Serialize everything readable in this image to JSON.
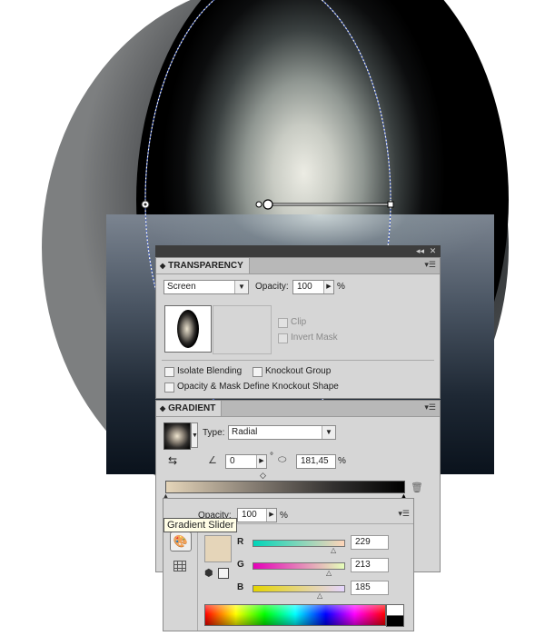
{
  "transparency": {
    "tab_title": "TRANSPARENCY",
    "blend_mode": "Screen",
    "opacity_label": "Opacity:",
    "opacity_value": "100",
    "percent": "%",
    "clip_label": "Clip",
    "invert_mask_label": "Invert Mask",
    "isolate_blending_label": "Isolate Blending",
    "knockout_group_label": "Knockout Group",
    "opacity_mask_label": "Opacity & Mask Define Knockout Shape"
  },
  "gradient": {
    "tab_title": "GRADIENT",
    "type_label": "Type:",
    "type_value": "Radial",
    "angle_value": "0",
    "degree_symbol": "°",
    "aspect_value": "181,45",
    "percent": "%"
  },
  "tooltip": {
    "text": "Gradient Slider"
  },
  "color": {
    "opacity_label": "Opacity:",
    "opacity_value": "100",
    "percent": "%",
    "swatch": "#e5d5b9",
    "r_label": "R",
    "g_label": "G",
    "b_label": "B",
    "r_value": "229",
    "g_value": "213",
    "b_value": "185"
  },
  "icons": {
    "panel_menu": "panel-menu-icon",
    "collapse": "collapse-icon",
    "close": "close-icon",
    "delete": "trash-icon",
    "reverse": "reverse-gradient-icon",
    "angle": "angle-icon",
    "aspect": "aspect-ratio-icon",
    "palette": "palette-icon",
    "grid": "grid-icon",
    "out_of_gamut": "cube-icon",
    "web_safe": "square-icon"
  }
}
